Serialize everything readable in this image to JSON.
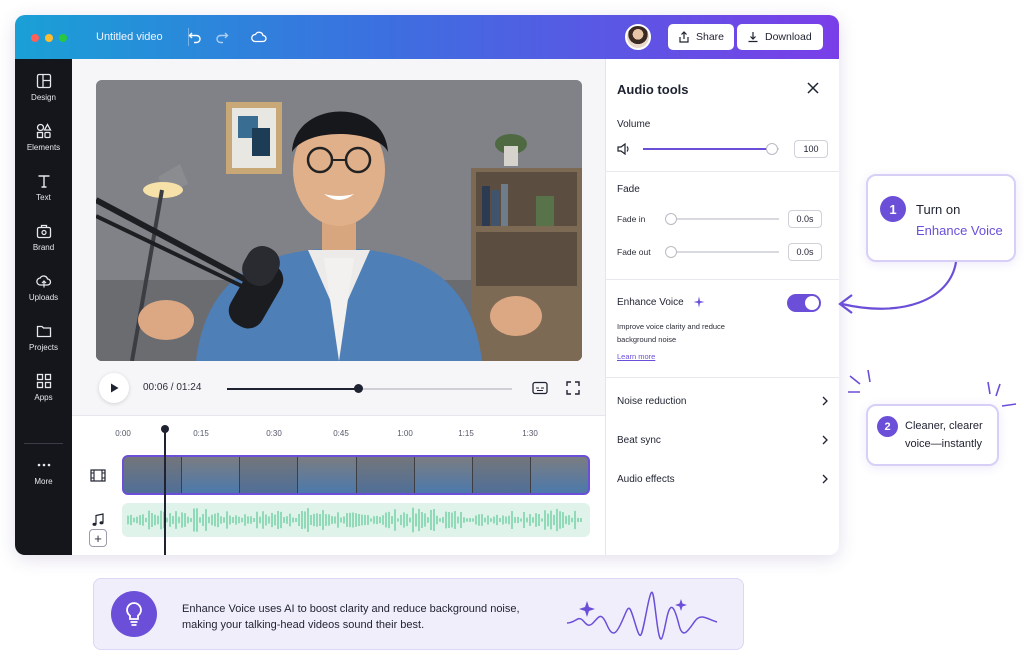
{
  "window": {
    "title": "Untitled video",
    "traffic_colors": [
      "#ff5f57",
      "#febc2e",
      "#28c840"
    ],
    "share_label": "Share",
    "download_label": "Download"
  },
  "sidebar": {
    "items": [
      {
        "label": "Design",
        "icon": "layout-icon"
      },
      {
        "label": "Elements",
        "icon": "shapes-icon"
      },
      {
        "label": "Text",
        "icon": "text-icon"
      },
      {
        "label": "Brand",
        "icon": "brand-icon"
      },
      {
        "label": "Uploads",
        "icon": "upload-cloud-icon"
      },
      {
        "label": "Projects",
        "icon": "folder-icon"
      },
      {
        "label": "Apps",
        "icon": "apps-grid-icon"
      }
    ],
    "more_label": "More"
  },
  "player": {
    "timecode": "00:06 / 01:24",
    "progress": 0.46
  },
  "timeline": {
    "ticks": [
      "0:00",
      "0:15",
      "0:30",
      "0:45",
      "1:00",
      "1:15",
      "1:30"
    ]
  },
  "panel": {
    "title": "Audio tools",
    "volume": {
      "label": "Volume",
      "value": "100",
      "level": 0.95
    },
    "fade": {
      "label": "Fade",
      "fade_in_label": "Fade in",
      "fade_in_value": "0.0s",
      "fade_out_label": "Fade out",
      "fade_out_value": "0.0s"
    },
    "enhance": {
      "label": "Enhance Voice",
      "enabled": true,
      "description": "Improve voice clarity and reduce background noise",
      "link": "Learn more"
    },
    "rows": [
      "Noise reduction",
      "Beat sync",
      "Audio effects"
    ]
  },
  "callouts": {
    "first": {
      "number": "1",
      "line1": "Turn on",
      "line2": "Enhance Voice"
    },
    "second": {
      "number": "2",
      "line1": "Cleaner, clearer",
      "line2": "voice—instantly"
    }
  },
  "tip": {
    "line1": "Enhance Voice uses AI to boost clarity and reduce background noise,",
    "line2": "making your talking-head videos sound their best."
  },
  "colors": {
    "accent": "#6b4fd8",
    "audio_wave": "#6fcfa3"
  }
}
